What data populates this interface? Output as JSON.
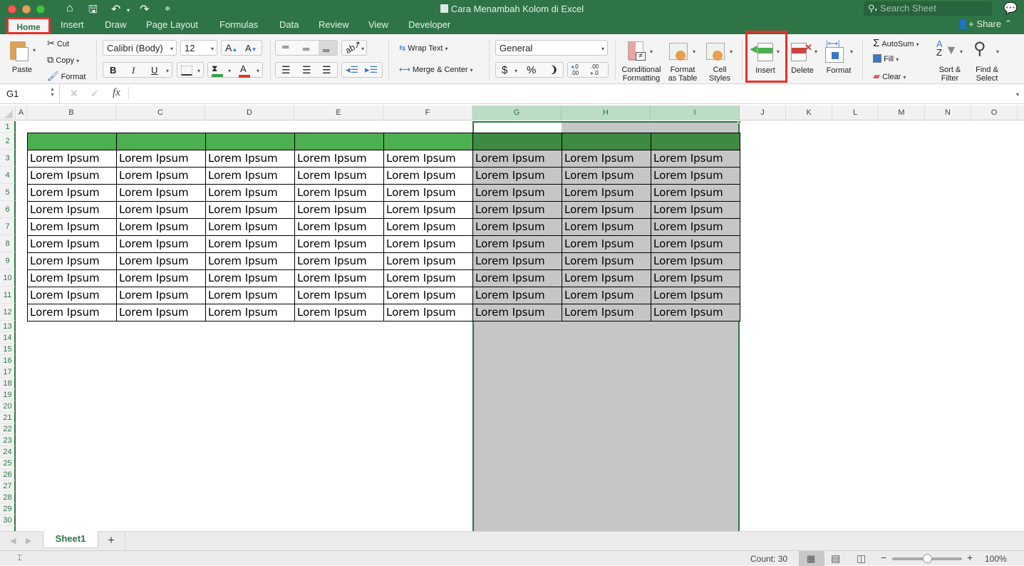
{
  "window": {
    "title": "Cara Menambah Kolom di Excel",
    "search_placeholder": "Search Sheet",
    "share_label": "Share"
  },
  "tabs": [
    "Home",
    "Insert",
    "Draw",
    "Page Layout",
    "Formulas",
    "Data",
    "Review",
    "View",
    "Developer"
  ],
  "active_tab": "Home",
  "ribbon": {
    "paste": "Paste",
    "cut": "Cut",
    "copy": "Copy",
    "format_painter": "Format",
    "font_name": "Calibri (Body)",
    "font_size": "12",
    "bold": "B",
    "italic": "I",
    "underline": "U",
    "wrap_text": "Wrap Text",
    "merge_center": "Merge & Center",
    "number_format": "General",
    "currency": "$",
    "percent": "%",
    "comma": "❩",
    "conditional_formatting": [
      "Conditional",
      "Formatting"
    ],
    "format_as_table": [
      "Format",
      "as Table"
    ],
    "cell_styles": [
      "Cell",
      "Styles"
    ],
    "insert": "Insert",
    "delete": "Delete",
    "format": "Format",
    "autosum": "AutoSum",
    "fill": "Fill",
    "clear": "Clear",
    "sort_filter": [
      "Sort &",
      "Filter"
    ],
    "find_select": [
      "Find &",
      "Select"
    ]
  },
  "formula_bar": {
    "name_box": "G1",
    "fx": "fx",
    "value": ""
  },
  "grid": {
    "columns": [
      "A",
      "B",
      "C",
      "D",
      "E",
      "F",
      "G",
      "H",
      "I",
      "J",
      "K",
      "L",
      "M",
      "N",
      "O"
    ],
    "selected_columns": [
      "G",
      "H",
      "I"
    ],
    "rows": [
      "1",
      "2",
      "3",
      "4",
      "5",
      "6",
      "7",
      "8",
      "9",
      "10",
      "11",
      "12",
      "13",
      "14",
      "15",
      "16",
      "17",
      "18",
      "19",
      "20",
      "21",
      "22",
      "23",
      "24",
      "25",
      "26",
      "27",
      "28",
      "29",
      "30"
    ],
    "cell_text": "Lorem Ipsum",
    "header_fill": "#4caf50",
    "header_fill_selected": "#3d8a40",
    "selection_fill": "#c6c6c6"
  },
  "sheets": [
    "Sheet1"
  ],
  "add_sheet": "+",
  "status": {
    "count": "Count: 30",
    "zoom": "100%",
    "zoom_level": 1.0
  }
}
